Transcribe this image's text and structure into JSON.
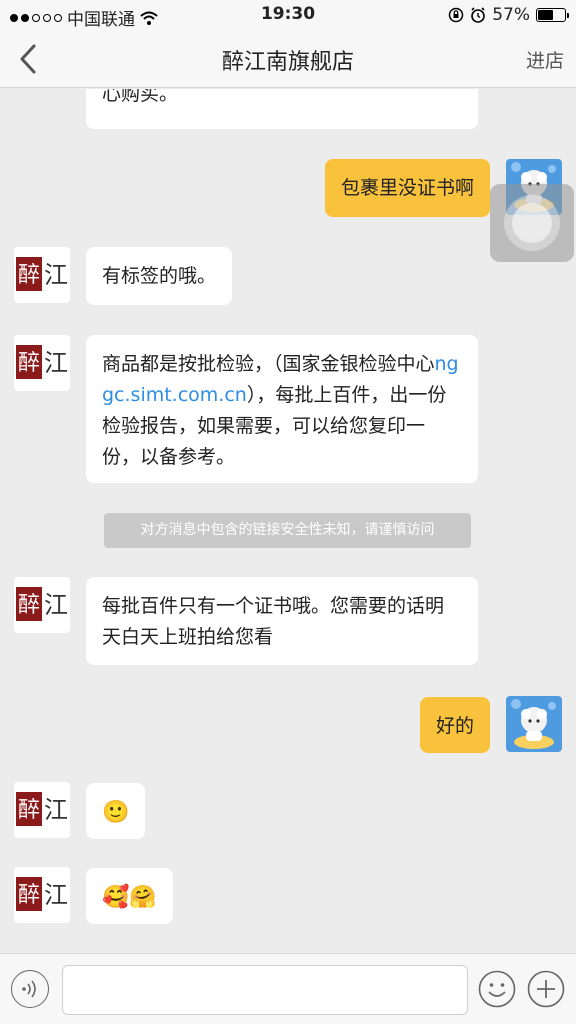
{
  "status": {
    "carrier": "中国联通",
    "time": "19:30",
    "battery": "57%",
    "battery_level": 0.57
  },
  "nav": {
    "title": "醉江南旗舰店",
    "action_label": "进店",
    "back_icon": "chevron-left-icon"
  },
  "shop": {
    "logo_text_1": "醉",
    "logo_text_2": "江"
  },
  "messages": [
    {
      "id": "m0",
      "side": "in",
      "text": "心购买。"
    },
    {
      "id": "m1",
      "side": "out",
      "text": "包裹里没证书啊"
    },
    {
      "id": "m2",
      "side": "in",
      "text": "有标签的哦。"
    },
    {
      "id": "m3",
      "side": "in",
      "text_before": "商品都是按批检验，（国家金银检验中心",
      "link": "nggc.simt.com.cn",
      "text_after": "），每批上百件，出一份检验报告，如果需要，可以给您复印一份，以备参考。"
    },
    {
      "id": "m4",
      "side": "in",
      "text": "每批百件只有一个证书哦。您需要的话明天白天上班拍给您看"
    },
    {
      "id": "m5",
      "side": "out",
      "text": "好的"
    },
    {
      "id": "m6",
      "side": "in",
      "emoji": "🙂"
    },
    {
      "id": "m7",
      "side": "in",
      "emoji": "🥰🤗"
    }
  ],
  "notice": "对方消息中包含的链接安全性未知，请谨慎访问",
  "input": {
    "placeholder": "",
    "value": ""
  },
  "colors": {
    "accent": "#f9c23c",
    "link": "#2d8de4",
    "background": "#ececec"
  }
}
